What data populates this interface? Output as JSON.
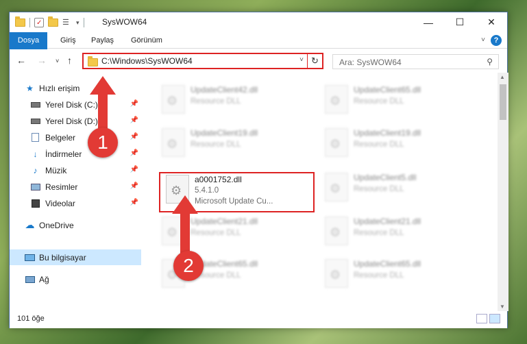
{
  "window": {
    "title": "SysWOW64",
    "controls": {
      "minimize": "—",
      "maximize": "☐",
      "close": "✕"
    }
  },
  "ribbon": {
    "tabs": [
      "Dosya",
      "Giriş",
      "Paylaş",
      "Görünüm"
    ],
    "help": "?"
  },
  "address": {
    "path": "C:\\Windows\\SysWOW64",
    "search_placeholder": "Ara: SysWOW64"
  },
  "nav": {
    "items": [
      {
        "label": "Hızlı erişim",
        "icon": "star-icon",
        "pinned": false
      },
      {
        "label": "Yerel Disk (C:)",
        "icon": "drive-icon",
        "pinned": true
      },
      {
        "label": "Yerel Disk (D:)",
        "icon": "drive-icon",
        "pinned": true
      },
      {
        "label": "Belgeler",
        "icon": "documents-icon",
        "pinned": true
      },
      {
        "label": "İndirmeler",
        "icon": "download-icon",
        "pinned": true
      },
      {
        "label": "Müzik",
        "icon": "music-icon",
        "pinned": true
      },
      {
        "label": "Resimler",
        "icon": "pictures-icon",
        "pinned": true
      },
      {
        "label": "Videolar",
        "icon": "video-icon",
        "pinned": true
      },
      {
        "label": "OneDrive",
        "icon": "cloud-icon",
        "pinned": false
      },
      {
        "label": "Bu bilgisayar",
        "icon": "computer-icon",
        "pinned": false
      },
      {
        "label": "Ağ",
        "icon": "network-icon",
        "pinned": false
      }
    ]
  },
  "files": {
    "highlighted": {
      "name": "a0001752.dll",
      "version": "5.4.1.0",
      "description": "Microsoft Update Cu..."
    },
    "blurred": [
      {
        "name": "UpdateClient42.dll",
        "sub": "Resource DLL"
      },
      {
        "name": "UpdateClient65.dll",
        "sub": "Resource DLL"
      },
      {
        "name": "UpdateClient19.dll",
        "sub": "Resource DLL"
      },
      {
        "name": "UpdateClient19.dll",
        "sub": "Resource DLL"
      },
      {
        "name": "UpdateClient5.dll",
        "sub": "Resource DLL"
      },
      {
        "name": "UpdateClient21.dll",
        "sub": "Resource DLL"
      },
      {
        "name": "UpdateClient21.dll",
        "sub": "Resource DLL"
      },
      {
        "name": "UpdateClient65.dll",
        "sub": "Resource DLL"
      },
      {
        "name": "UpdateClient65.dll",
        "sub": "Resource DLL"
      }
    ]
  },
  "status": {
    "count": "101 öğe"
  },
  "callouts": {
    "one": "1",
    "two": "2"
  },
  "colors": {
    "accent": "#1979ca",
    "highlight": "#dd2222",
    "callout": "#e23a35"
  }
}
